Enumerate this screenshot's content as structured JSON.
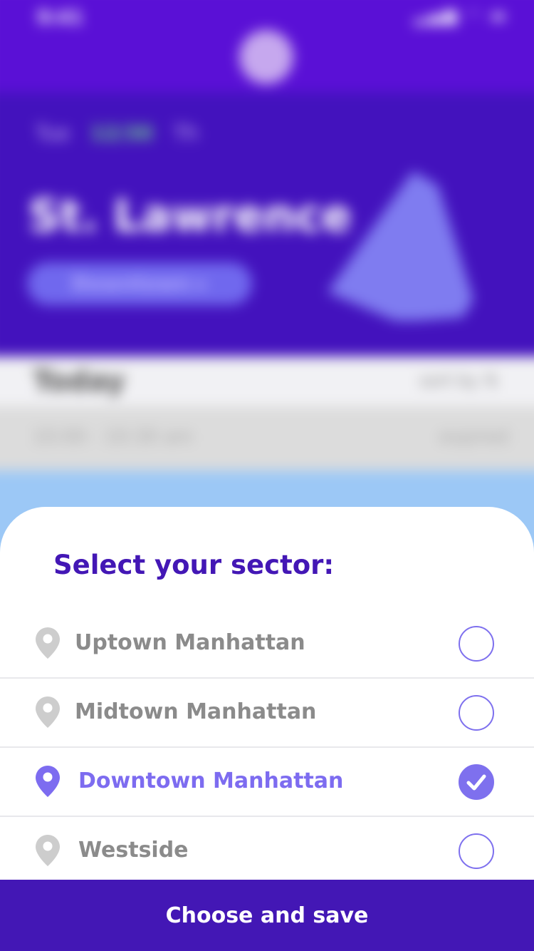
{
  "background": {
    "status_time": "9:41",
    "status_icons": "▂▄▆ ◠ ▬",
    "date_prev": "Tue",
    "date_current": "12/30",
    "date_next": "Th",
    "location": "St. Lawrence",
    "sector_pill": "Downtown ▸",
    "today": "Today",
    "today_right": "sort by ⇅",
    "slot_time": "10:00 - 10:30 am",
    "slot_state": "expired"
  },
  "sheet": {
    "title": "Select your sector:",
    "options": [
      {
        "label": "Uptown Manhattan",
        "selected": false
      },
      {
        "label": "Midtown Manhattan",
        "selected": false
      },
      {
        "label": "Downtown Manhattan",
        "selected": true
      },
      {
        "label": "Westside",
        "selected": false
      }
    ],
    "save_label": "Choose and save"
  },
  "colors": {
    "primary": "#4317b5",
    "accent": "#7e70ee",
    "option_text": "#8b8b8b",
    "pin_inactive": "#cdcdcd",
    "pin_active": "#7d6cf0",
    "divider": "#e8e8ec"
  },
  "icons": {
    "option_icon": "location-pin-icon",
    "selected_icon": "checkmark-icon"
  }
}
